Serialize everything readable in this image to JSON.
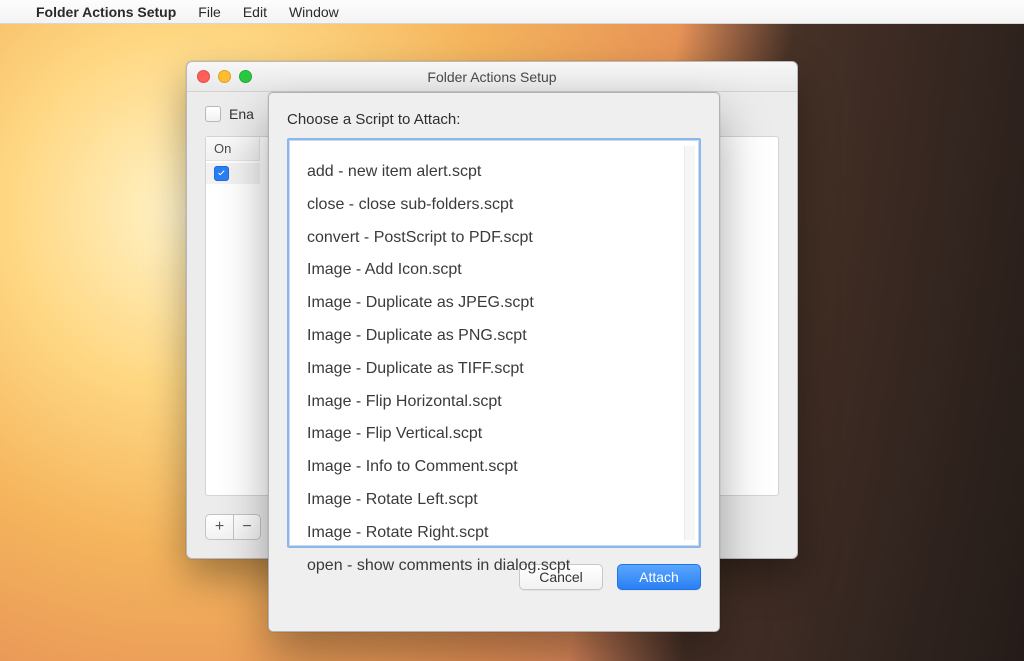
{
  "menubar": {
    "apple": "",
    "appname": "Folder Actions Setup",
    "items": [
      "File",
      "Edit",
      "Window"
    ]
  },
  "window": {
    "title": "Folder Actions Setup",
    "enable_label_visible": "Ena",
    "on_header": "On",
    "add_label": "+",
    "remove_label": "−"
  },
  "sheet": {
    "title": "Choose a Script to Attach:",
    "buttons": {
      "cancel": "Cancel",
      "attach": "Attach"
    },
    "scripts": [
      "add - new item alert.scpt",
      "close - close sub-folders.scpt",
      "convert - PostScript to PDF.scpt",
      "Image - Add Icon.scpt",
      "Image - Duplicate as JPEG.scpt",
      "Image - Duplicate as PNG.scpt",
      "Image - Duplicate as TIFF.scpt",
      "Image - Flip Horizontal.scpt",
      "Image - Flip Vertical.scpt",
      "Image - Info to Comment.scpt",
      "Image - Rotate Left.scpt",
      "Image - Rotate Right.scpt",
      "open - show comments in dialog.scpt"
    ]
  }
}
